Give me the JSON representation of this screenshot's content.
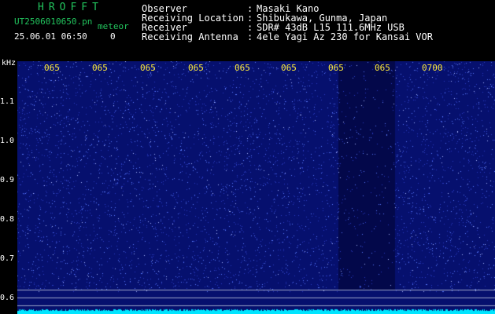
{
  "header": {
    "title": "HROFFT",
    "filename": "UT2506010650.pn",
    "meteor_label": "meteor",
    "datetime": "25.06.01 06:50",
    "count": "0"
  },
  "meta": [
    {
      "label": "Observer",
      "value": "Masaki Kano"
    },
    {
      "label": "Receiving Location",
      "value": "Shibukawa, Gunma, Japan"
    },
    {
      "label": "Receiver",
      "value": "SDR# 43dB L15 111.6MHz USB"
    },
    {
      "label": "Receiving Antenna",
      "value": "4ele Yagi Az 230 for Kansai VOR"
    }
  ],
  "separator": ":",
  "axis": {
    "unit": "kHz",
    "y_ticks": [
      "1.1",
      "1.0",
      "0.9",
      "0.8",
      "0.7",
      "0.6"
    ],
    "x_ticks": [
      "065",
      "065",
      "065",
      "065",
      "065",
      "065",
      "065",
      "065",
      "0700"
    ]
  },
  "colors": {
    "background": "#000000",
    "spectrogram_base": "#06106e",
    "noise_dot": "#5a7cff",
    "baseline": "#00e5ff",
    "title_green": "#22c55e",
    "tick_yellow": "#ffeb3b"
  }
}
